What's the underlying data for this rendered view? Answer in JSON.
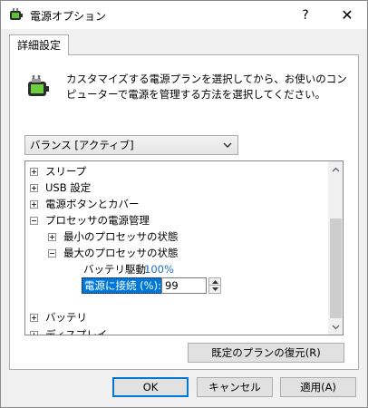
{
  "window": {
    "title": "電源オプション",
    "help_label": "?",
    "close_label": "✕"
  },
  "tab": {
    "label": "詳細設定"
  },
  "description": "カスタマイズする電源プランを選択してから、お使いのコンピューターで電源を管理する方法を選択してください。",
  "plan_select": {
    "value": "バランス [アクティブ]"
  },
  "tree": {
    "items": [
      {
        "label": "スリープ"
      },
      {
        "label": "USB 設定"
      },
      {
        "label": "電源ボタンとカバー"
      },
      {
        "label": "プロセッサの電源管理"
      },
      {
        "label": "最小のプロセッサの状態"
      },
      {
        "label": "最大のプロセッサの状態"
      },
      {
        "label": "ディスプレイ"
      },
      {
        "label": "バッテリ"
      }
    ],
    "battery_setting": {
      "label": "バッテリ駆動:",
      "value": "100%"
    },
    "plugged_setting": {
      "label": "電源に接続 (%):",
      "value": "99"
    }
  },
  "buttons": {
    "restore": "既定のプランの復元(R)",
    "ok": "OK",
    "cancel": "キャンセル",
    "apply": "適用(A)"
  },
  "colors": {
    "accent": "#0078d7",
    "value_link": "#1e6fc2"
  }
}
